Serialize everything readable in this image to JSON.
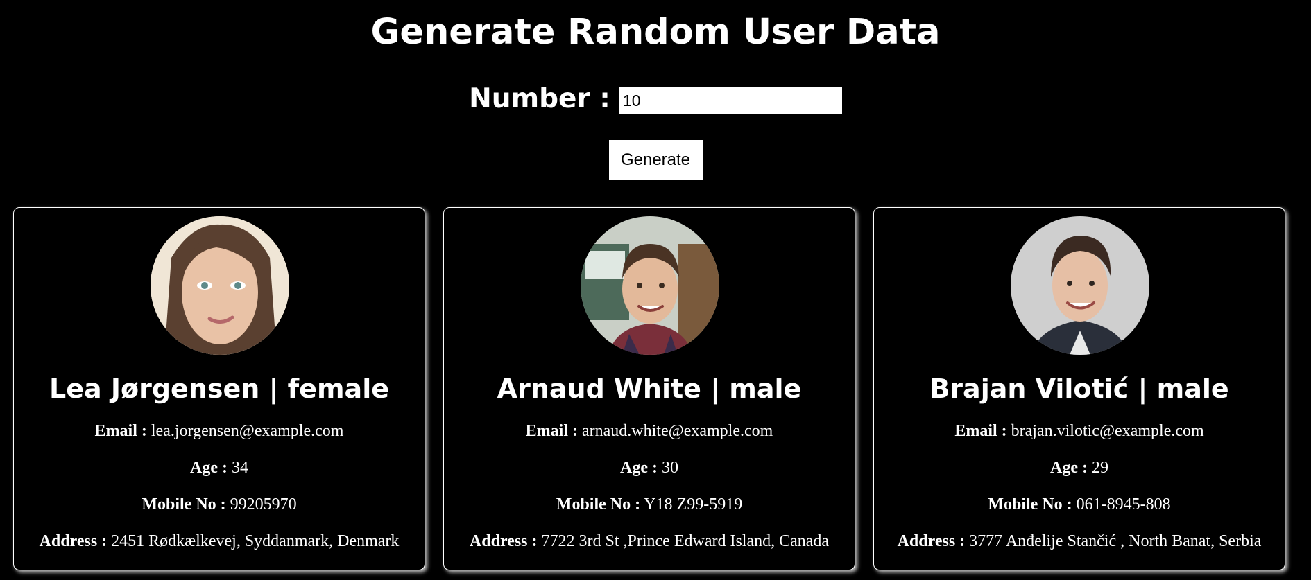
{
  "title": "Generate Random User Data",
  "form": {
    "number_label": "Number :",
    "number_value": "10",
    "generate_label": "Generate"
  },
  "labels": {
    "email": "Email :",
    "age": "Age :",
    "mobile": "Mobile No :",
    "address": "Address :"
  },
  "users": [
    {
      "name_gender": "Lea Jørgensen | female",
      "email": "lea.jorgensen@example.com",
      "age": "34",
      "mobile": "99205970",
      "address": "2451 Rødkælkevej, Syddanmark, Denmark"
    },
    {
      "name_gender": "Arnaud White | male",
      "email": "arnaud.white@example.com",
      "age": "30",
      "mobile": "Y18 Z99-5919",
      "address": "7722 3rd St ,Prince Edward Island, Canada"
    },
    {
      "name_gender": "Brajan Vilotić | male",
      "email": "brajan.vilotic@example.com",
      "age": "29",
      "mobile": "061-8945-808",
      "address": "3777 Anđelije Stančić , North Banat, Serbia"
    }
  ]
}
